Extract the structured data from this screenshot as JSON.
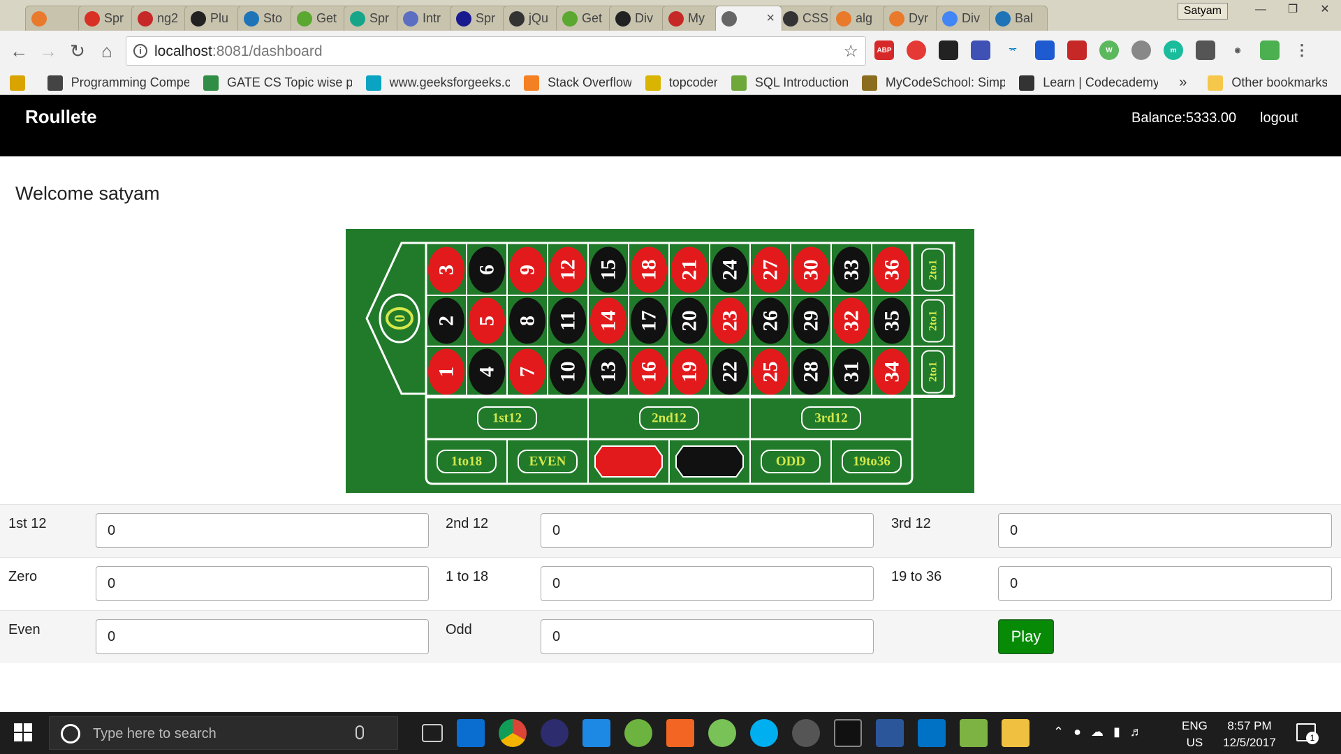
{
  "browser": {
    "tabs": [
      {
        "label": "",
        "color": "#e9792b"
      },
      {
        "label": "Spr",
        "color": "#d93025"
      },
      {
        "label": "ng2",
        "color": "#c62828"
      },
      {
        "label": "Plu",
        "color": "#222222"
      },
      {
        "label": "Sto",
        "color": "#1f74b8"
      },
      {
        "label": "Get",
        "color": "#5aa830"
      },
      {
        "label": "Spr",
        "color": "#17a589"
      },
      {
        "label": "Intr",
        "color": "#5b6ec2"
      },
      {
        "label": "Spr",
        "color": "#1a1a8f"
      },
      {
        "label": "jQu",
        "color": "#333333"
      },
      {
        "label": "Get",
        "color": "#5aa830"
      },
      {
        "label": "Div",
        "color": "#222222"
      },
      {
        "label": "My",
        "color": "#c62828"
      },
      {
        "label": "",
        "color": "#666666",
        "active": true
      },
      {
        "label": "CSS",
        "color": "#333333"
      },
      {
        "label": "alg",
        "color": "#e9792b"
      },
      {
        "label": "Dyr",
        "color": "#e9792b"
      },
      {
        "label": "Div",
        "color": "#4285f4"
      },
      {
        "label": "Bal",
        "color": "#1f74b8"
      }
    ],
    "user": "Satyam",
    "url_host": "localhost",
    "url_path": ":8081/dashboard",
    "bookmarks": [
      {
        "label": "",
        "color": "#d9a400"
      },
      {
        "label": "Programming Compe",
        "color": "#444444"
      },
      {
        "label": "GATE CS Topic wise p",
        "color": "#2f8d46"
      },
      {
        "label": "www.geeksforgeeks.c",
        "color": "#0aa3c2"
      },
      {
        "label": "Stack Overflow",
        "color": "#f48024"
      },
      {
        "label": "topcoder",
        "color": "#d9b400"
      },
      {
        "label": "SQL Introduction",
        "color": "#6fa83a"
      },
      {
        "label": "MyCodeSchool: Simp",
        "color": "#8a6d1e"
      },
      {
        "label": "Learn | Codecademy",
        "color": "#333333"
      }
    ],
    "bookmarks_more": "»",
    "other_bookmarks": "Other bookmarks"
  },
  "app": {
    "brand": "Roullete",
    "balance": "Balance:5333.00",
    "logout": "logout",
    "welcome": "Welcome satyam"
  },
  "roulette_board": {
    "zero": "0",
    "numbers": {
      "top": [
        "3",
        "6",
        "9",
        "12",
        "15",
        "18",
        "21",
        "24",
        "27",
        "30",
        "33",
        "36"
      ],
      "mid": [
        "2",
        "5",
        "8",
        "11",
        "14",
        "17",
        "20",
        "23",
        "26",
        "29",
        "32",
        "35"
      ],
      "bot": [
        "1",
        "4",
        "7",
        "10",
        "13",
        "16",
        "19",
        "22",
        "25",
        "28",
        "31",
        "34"
      ]
    },
    "red_numbers": [
      "1",
      "3",
      "5",
      "7",
      "9",
      "12",
      "14",
      "16",
      "18",
      "19",
      "21",
      "23",
      "25",
      "27",
      "30",
      "32",
      "34",
      "36"
    ],
    "column_label": "2to1",
    "dozens": [
      "1st12",
      "2nd12",
      "3rd12"
    ],
    "outside": [
      "1to18",
      "EVEN",
      "",
      "",
      "ODD",
      "19to36"
    ],
    "colors": {
      "felt": "#217a2a",
      "red": "#e31a1c",
      "black": "#111111",
      "gold": "#d4e84b",
      "line": "#ffffff"
    }
  },
  "bets": {
    "rows": [
      [
        {
          "label": "1st 12",
          "value": "0"
        },
        {
          "label": "2nd 12",
          "value": "0"
        },
        {
          "label": "3rd 12",
          "value": "0"
        }
      ],
      [
        {
          "label": "Zero",
          "value": "0"
        },
        {
          "label": "1 to 18",
          "value": "0"
        },
        {
          "label": "19 to 36",
          "value": "0"
        }
      ],
      [
        {
          "label": "Even",
          "value": "0"
        },
        {
          "label": "Odd",
          "value": "0"
        }
      ]
    ],
    "play_label": "Play"
  },
  "taskbar": {
    "search_placeholder": "Type here to search",
    "lang_top": "ENG",
    "lang_bottom": "US",
    "time": "8:57 PM",
    "date": "12/5/2017",
    "notif_count": "1"
  }
}
